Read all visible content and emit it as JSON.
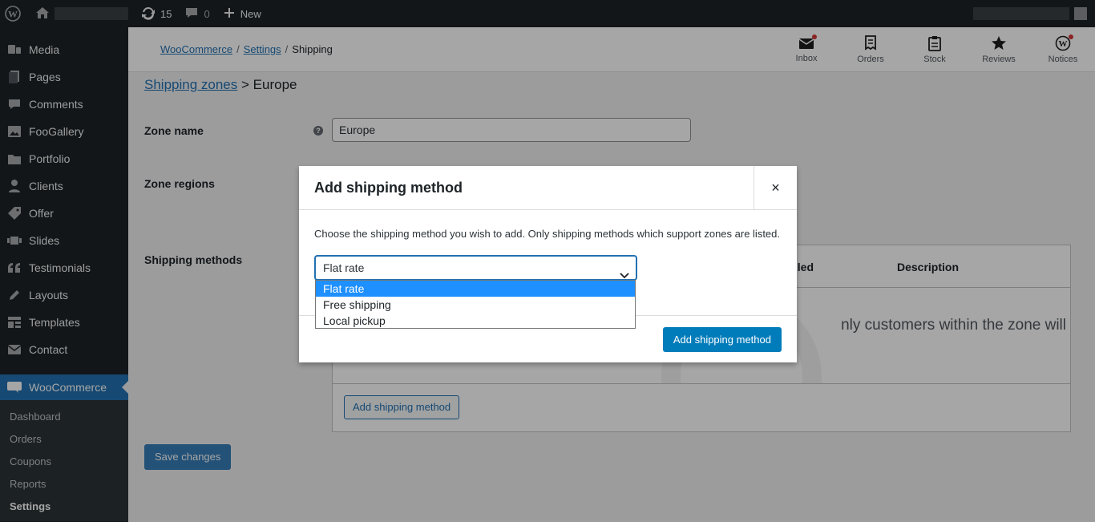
{
  "adminbar": {
    "updates_count": "15",
    "comments_count": "0",
    "new_label": "New"
  },
  "sidebar": {
    "items": [
      {
        "label": "Media",
        "icon": "media-icon"
      },
      {
        "label": "Pages",
        "icon": "pages-icon"
      },
      {
        "label": "Comments",
        "icon": "comments-icon"
      },
      {
        "label": "FooGallery",
        "icon": "gallery-icon"
      },
      {
        "label": "Portfolio",
        "icon": "portfolio-icon"
      },
      {
        "label": "Clients",
        "icon": "clients-icon"
      },
      {
        "label": "Offer",
        "icon": "offer-icon"
      },
      {
        "label": "Slides",
        "icon": "slides-icon"
      },
      {
        "label": "Testimonials",
        "icon": "testimonials-icon"
      },
      {
        "label": "Layouts",
        "icon": "layouts-icon"
      },
      {
        "label": "Templates",
        "icon": "templates-icon"
      },
      {
        "label": "Contact",
        "icon": "contact-icon"
      }
    ],
    "current": {
      "label": "WooCommerce",
      "icon": "woocommerce-icon"
    },
    "submenu": [
      "Dashboard",
      "Orders",
      "Coupons",
      "Reports",
      "Settings"
    ]
  },
  "wc_header": {
    "breadcrumb": [
      "WooCommerce",
      "Settings",
      "Shipping"
    ],
    "activity": [
      "Inbox",
      "Orders",
      "Stock",
      "Reviews",
      "Notices"
    ]
  },
  "main": {
    "zone_link": "Shipping zones",
    "zone_sep": ">",
    "zone_current": "Europe",
    "zone_name_label": "Zone name",
    "zone_name_value": "Europe",
    "zone_regions_label": "Zone regions",
    "shipping_methods_label": "Shipping methods",
    "table_col_enabled": "led",
    "table_col_description": "Description",
    "table_blank_text": "nly customers within the zone will",
    "add_method_button": "Add shipping method",
    "save_button": "Save changes"
  },
  "modal": {
    "title": "Add shipping method",
    "close": "×",
    "description": "Choose the shipping method you wish to add. Only shipping methods which support zones are listed.",
    "selected_value": "Flat rate",
    "options": [
      "Flat rate",
      "Free shipping",
      "Local pickup"
    ],
    "submit_button": "Add shipping method"
  },
  "colors": {
    "admin_dark": "#1d2327",
    "accent_blue": "#2271b1",
    "primary_button": "#007cba",
    "dropdown_highlight": "#1e90ff",
    "notification_dot": "#d63638"
  }
}
